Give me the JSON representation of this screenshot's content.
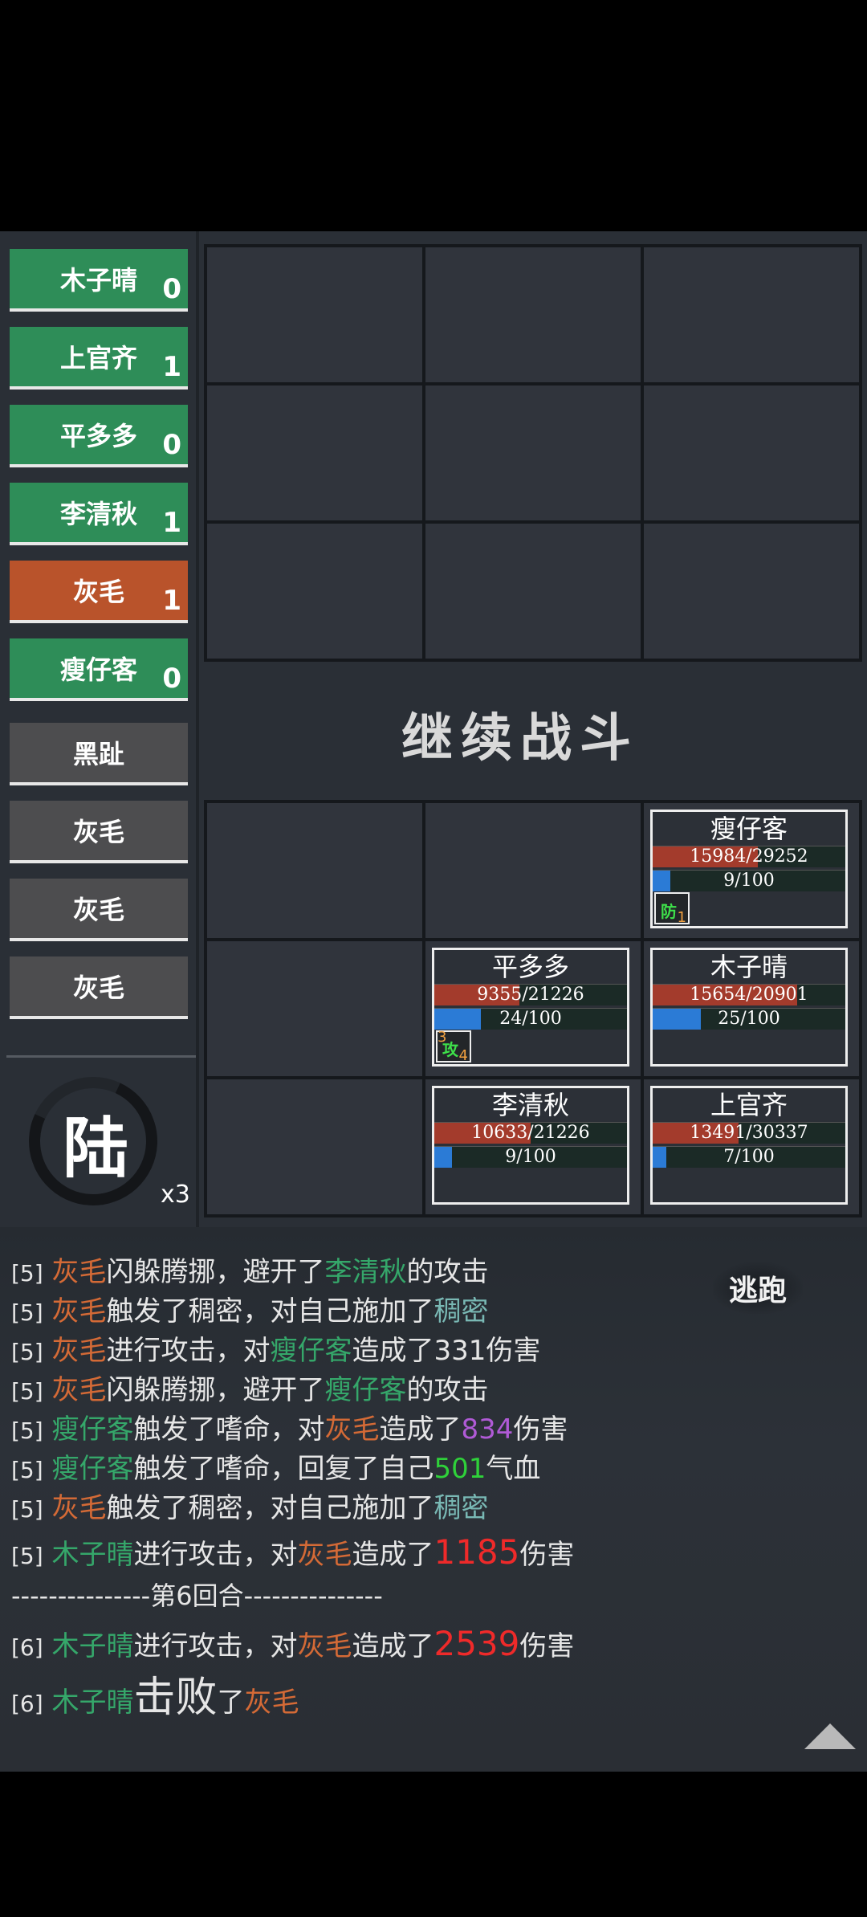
{
  "roster": [
    {
      "name": "木子晴",
      "count": "0",
      "side": "ally"
    },
    {
      "name": "上官齐",
      "count": "1",
      "side": "ally"
    },
    {
      "name": "平多多",
      "count": "0",
      "side": "ally"
    },
    {
      "name": "李清秋",
      "count": "1",
      "side": "ally"
    },
    {
      "name": "灰毛",
      "count": "1",
      "side": "active"
    },
    {
      "name": "瘦仔客",
      "count": "0",
      "side": "ally"
    },
    {
      "name": "黑趾",
      "count": "",
      "side": "enemy"
    },
    {
      "name": "灰毛",
      "count": "",
      "side": "enemy"
    },
    {
      "name": "灰毛",
      "count": "",
      "side": "enemy"
    },
    {
      "name": "灰毛",
      "count": "",
      "side": "enemy"
    }
  ],
  "round_char": "陆",
  "speed": "x3",
  "continue_label": "继续战斗",
  "flee_label": "逃跑",
  "cards": {
    "shouzaike": {
      "name": "瘦仔客",
      "hp": "15984/29252",
      "hp_frac": 0.546,
      "en": "9/100",
      "en_frac": 0.09,
      "buff": {
        "label": "防",
        "left": "",
        "right": "1"
      }
    },
    "pingduoduo": {
      "name": "平多多",
      "hp": "9355/21226",
      "hp_frac": 0.441,
      "en": "24/100",
      "en_frac": 0.24,
      "buff": {
        "label": "攻",
        "left": "3",
        "right": "4"
      }
    },
    "muziqing": {
      "name": "木子晴",
      "hp": "15654/20901",
      "hp_frac": 0.749,
      "en": "25/100",
      "en_frac": 0.25
    },
    "liqingqiu": {
      "name": "李清秋",
      "hp": "10633/21226",
      "hp_frac": 0.501,
      "en": "9/100",
      "en_frac": 0.09
    },
    "shangguanqi": {
      "name": "上官齐",
      "hp": "13491/30337",
      "hp_frac": 0.445,
      "en": "7/100",
      "en_frac": 0.07
    }
  },
  "log": {
    "l1": {
      "r": "[5]",
      "a": "灰毛",
      "b": "闪躲腾挪，避开了",
      "c": "李清秋",
      "d": "的攻击"
    },
    "l2": {
      "r": "[5]",
      "a": "灰毛",
      "b": "触发了稠密，对自己施加了",
      "c": "稠密"
    },
    "l3": {
      "r": "[5]",
      "a": "灰毛",
      "b": "进行攻击，对",
      "c": "瘦仔客",
      "d": "造成了331伤害"
    },
    "l4": {
      "r": "[5]",
      "a": "灰毛",
      "b": "闪躲腾挪，避开了",
      "c": "瘦仔客",
      "d": "的攻击"
    },
    "l5": {
      "r": "[5]",
      "a": "瘦仔客",
      "b": "触发了嗜命，对",
      "c": "灰毛",
      "d": "造成了",
      "e": "834",
      "f": "伤害"
    },
    "l6": {
      "r": "[5]",
      "a": "瘦仔客",
      "b": "触发了嗜命，回复了自己",
      "c": "501",
      "d": "气血"
    },
    "l7": {
      "r": "[5]",
      "a": "灰毛",
      "b": "触发了稠密，对自己施加了",
      "c": "稠密"
    },
    "l8": {
      "r": "[5]",
      "a": "木子晴",
      "b": "进行攻击，对",
      "c": "灰毛",
      "d": "造成了",
      "e": "1185",
      "f": "伤害"
    },
    "sep": "---------------第6回合---------------",
    "l9": {
      "r": "[6]",
      "a": "木子晴",
      "b": "进行攻击，对",
      "c": "灰毛",
      "d": "造成了",
      "e": "2539",
      "f": "伤害"
    },
    "l10": {
      "r": "[6]",
      "a": "木子晴",
      "b": "击败",
      "c": "了",
      "d": "灰毛"
    }
  }
}
